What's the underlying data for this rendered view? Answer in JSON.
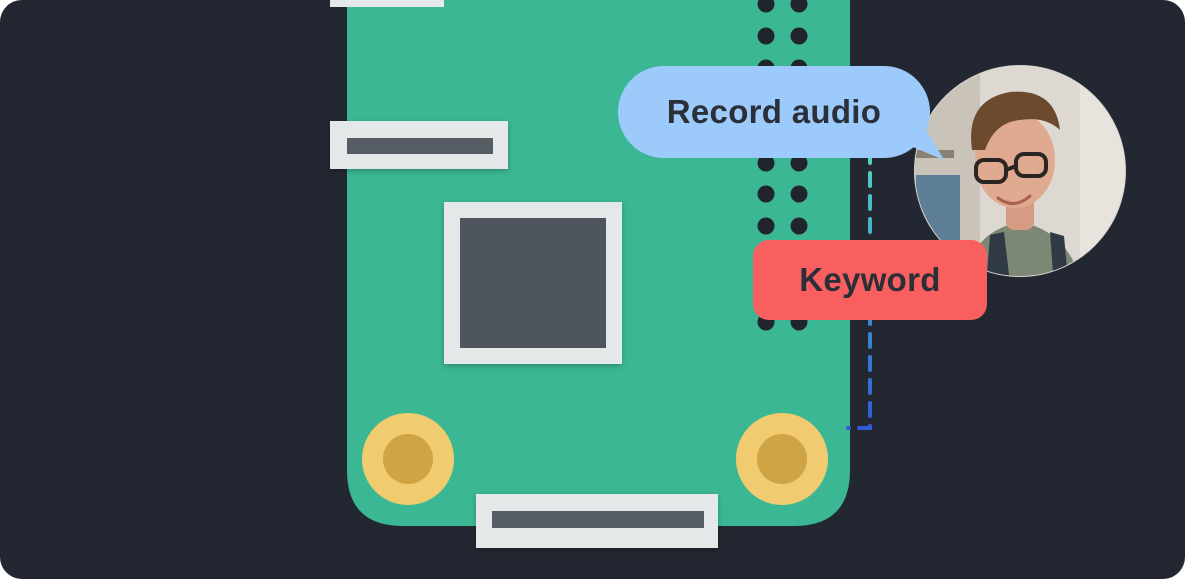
{
  "diagram": {
    "speech_bubble": {
      "label": "Record audio"
    },
    "keyword_tag": {
      "label": "Keyword"
    },
    "avatar": {
      "description": "person-photo"
    }
  },
  "colors": {
    "background": "#222731",
    "board": "#3bb794",
    "chip": "#4f545c",
    "connector_frame": "#e5e8e9",
    "mount_hole": "#f1cb6f",
    "speech_bubble": "#9ccbfb",
    "keyword_tag": "#f95f5f",
    "dash_line_top": "#4fd6c1",
    "dash_line_bottom": "#2f5bd6"
  }
}
